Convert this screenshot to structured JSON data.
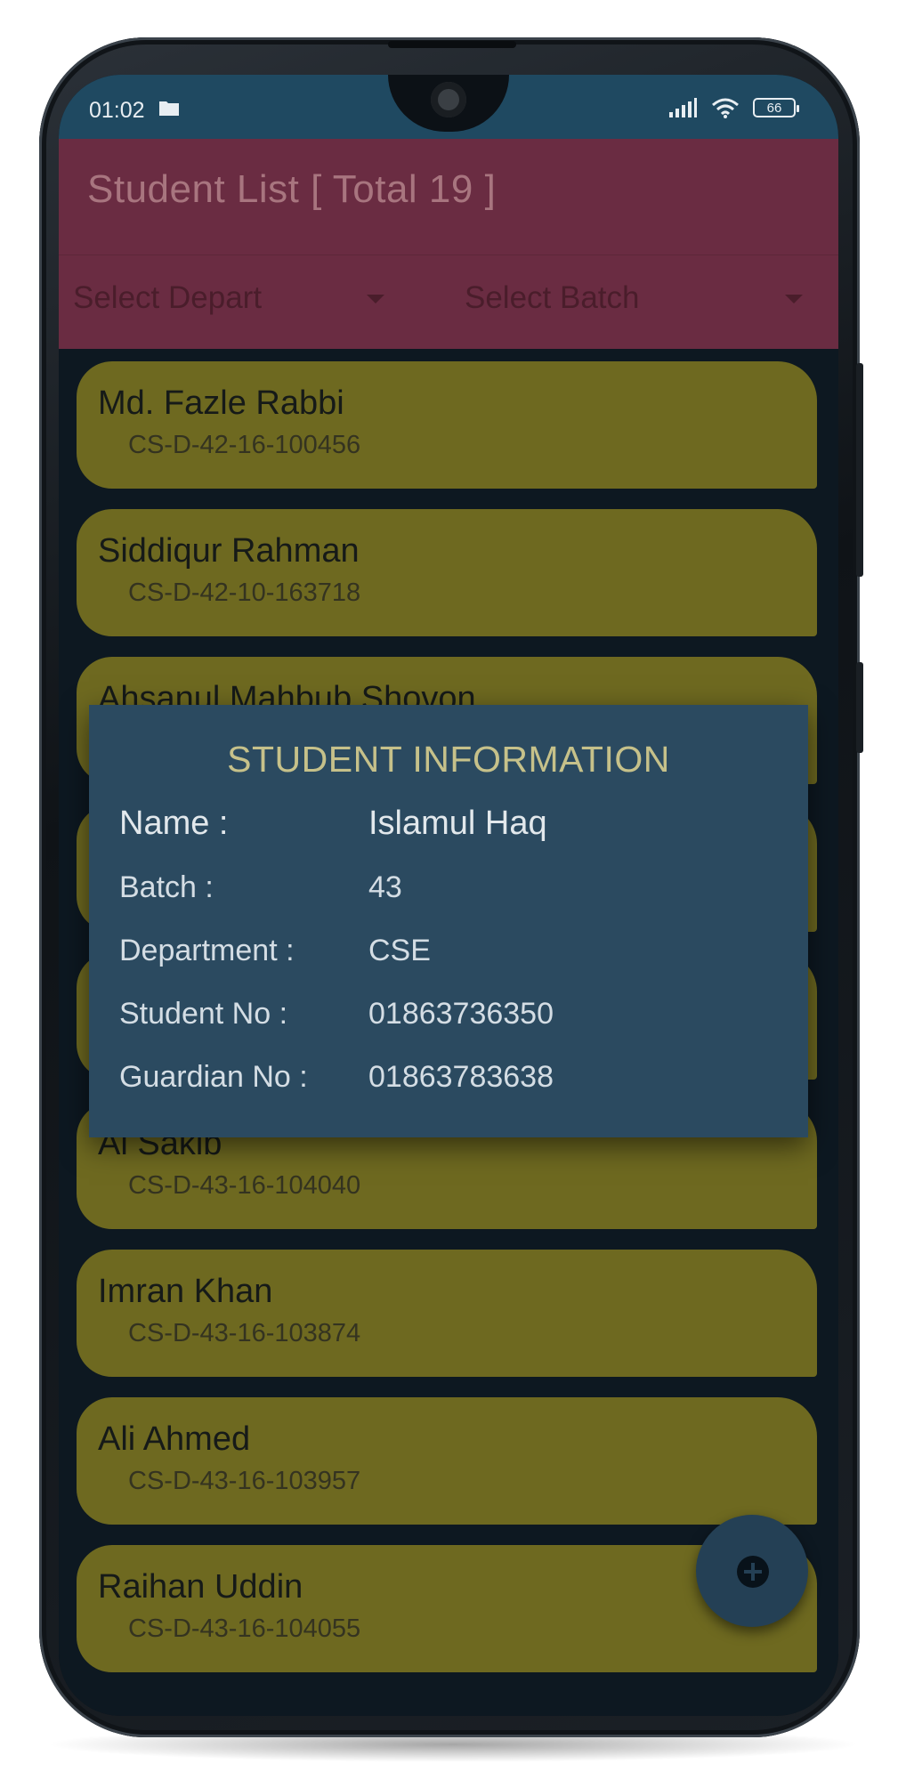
{
  "status_bar": {
    "time": "01:02",
    "battery": "66",
    "icons": [
      "folder-icon",
      "signal-icon",
      "wifi-icon",
      "battery-icon"
    ]
  },
  "app_bar": {
    "title": "Student List [ Total 19 ]",
    "department_dropdown": "Select Depart",
    "batch_dropdown": "Select Batch"
  },
  "students": [
    {
      "name": "Md. Fazle Rabbi",
      "id": "CS-D-42-16-100456"
    },
    {
      "name": "Siddiqur Rahman",
      "id": "CS-D-42-10-163718"
    },
    {
      "name": "Ahsanul Mahbub Shovon",
      "id": ""
    },
    {
      "name": "",
      "id": ""
    },
    {
      "name": "",
      "id": ""
    },
    {
      "name": "Al Sakib",
      "id": "CS-D-43-16-104040"
    },
    {
      "name": "Imran Khan",
      "id": "CS-D-43-16-103874"
    },
    {
      "name": "Ali Ahmed",
      "id": "CS-D-43-16-103957"
    },
    {
      "name": "Raihan Uddin",
      "id": "CS-D-43-16-104055"
    }
  ],
  "dialog": {
    "title": "STUDENT INFORMATION",
    "rows": [
      {
        "label": "Name :",
        "value": "Islamul Haq"
      },
      {
        "label": "Batch :",
        "value": "43"
      },
      {
        "label": "Department :",
        "value": "CSE"
      },
      {
        "label": "Student No :",
        "value": "01863736350"
      },
      {
        "label": "Guardian No :",
        "value": "01863783638"
      }
    ]
  },
  "fab": {
    "icon": "plus-icon"
  },
  "colors": {
    "status_bar": "#1f4961",
    "app_bar": "#6a2c42",
    "card": "#6e6920",
    "dialog": "#2b4a60",
    "dialog_title": "#c6c18a"
  }
}
